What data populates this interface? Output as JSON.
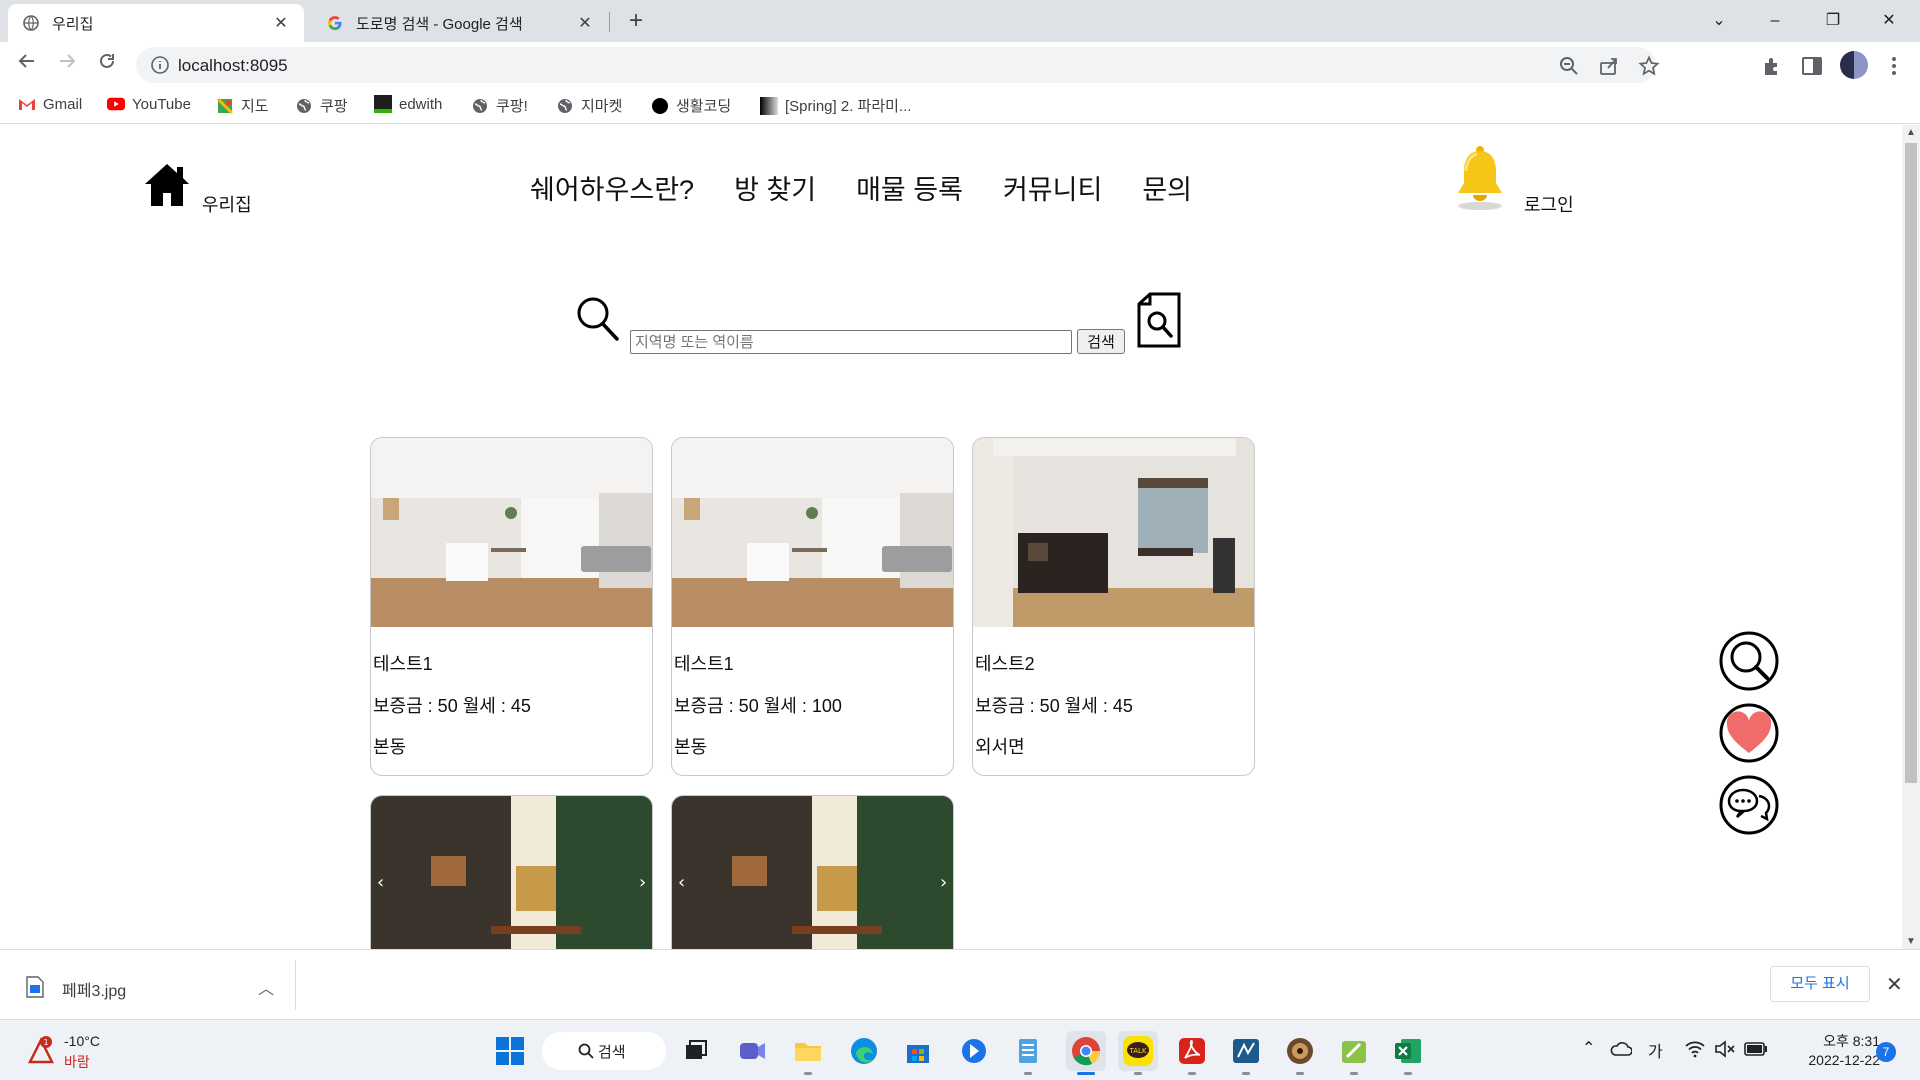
{
  "browser": {
    "tabs": [
      {
        "title": "우리집",
        "close": "✕"
      },
      {
        "title": "도로명 검색 - Google 검색",
        "close": "✕"
      }
    ],
    "new_tab": "+",
    "url": "localhost:8095",
    "window": {
      "minimize": "–",
      "restore": "❐",
      "close": "✕",
      "tab_search": "⌄"
    },
    "bookmarks": [
      "Gmail",
      "YouTube",
      "지도",
      "쿠팡",
      "edwith",
      "쿠팡!",
      "지마켓",
      "생활코딩",
      "[Spring] 2. 파라미..."
    ]
  },
  "site": {
    "logo_text": "우리집",
    "nav": [
      "쉐어하우스란?",
      "방 찾기",
      "매물 등록",
      "커뮤니티",
      "문의"
    ],
    "login": "로그인",
    "search": {
      "placeholder": "지역명 또는 역이름",
      "button": "검색"
    }
  },
  "cards": [
    {
      "name": "테스트1",
      "price": "보증금 : 50 월세 : 45",
      "location": "본동"
    },
    {
      "name": "테스트1",
      "price": "보증금 : 50 월세 : 100",
      "location": "본동"
    },
    {
      "name": "테스트2",
      "price": "보증금 : 50 월세 : 45",
      "location": "외서면"
    }
  ],
  "floating_buttons": [
    "search-icon",
    "heart-icon",
    "chat-icon"
  ],
  "download": {
    "filename": "페페3.jpg",
    "show_all": "모두 표시",
    "close": "✕"
  },
  "taskbar": {
    "weather_temp": "-10°C",
    "weather_desc": "바람",
    "weather_badge": "1",
    "search": "검색",
    "ime": "가",
    "time": "오후 8:31",
    "date": "2022-12-22",
    "notifications": "7"
  },
  "colors": {
    "accent": "#1a73e8",
    "heart": "#f26b6b",
    "bell": "#f5c518"
  }
}
